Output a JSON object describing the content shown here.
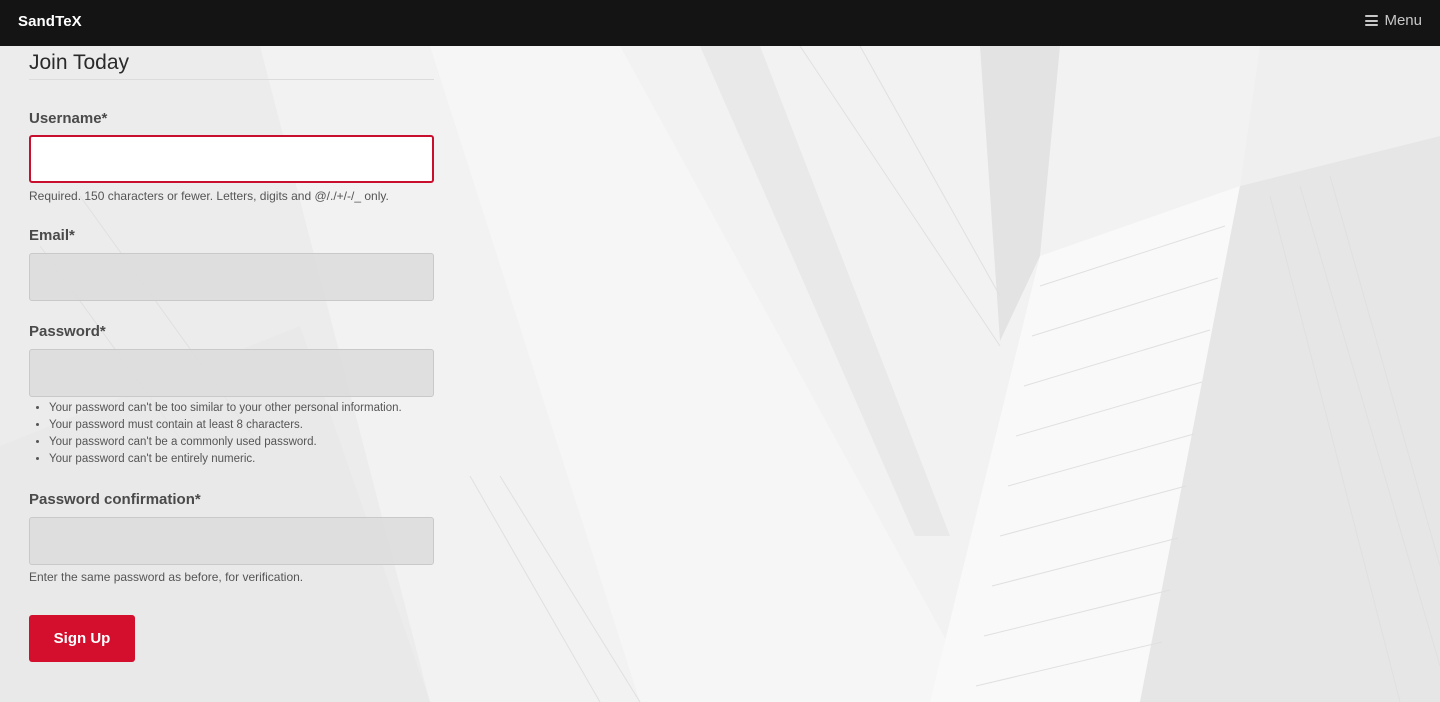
{
  "navbar": {
    "brand": "SandTeX",
    "menu_label": "Menu"
  },
  "form": {
    "legend": "Join Today",
    "username": {
      "label": "Username*",
      "value": "",
      "help": "Required. 150 characters or fewer. Letters, digits and @/./+/-/_ only."
    },
    "email": {
      "label": "Email*",
      "value": ""
    },
    "password": {
      "label": "Password*",
      "value": "",
      "rules": [
        "Your password can't be too similar to your other personal information.",
        "Your password must contain at least 8 characters.",
        "Your password can't be a commonly used password.",
        "Your password can't be entirely numeric."
      ]
    },
    "password_confirmation": {
      "label": "Password confirmation*",
      "value": "",
      "help": "Enter the same password as before, for verification."
    },
    "submit_label": "Sign Up"
  },
  "colors": {
    "navbar_bg": "#141414",
    "accent": "#d40f2d"
  },
  "icons": {
    "menu": "hamburger-icon"
  }
}
